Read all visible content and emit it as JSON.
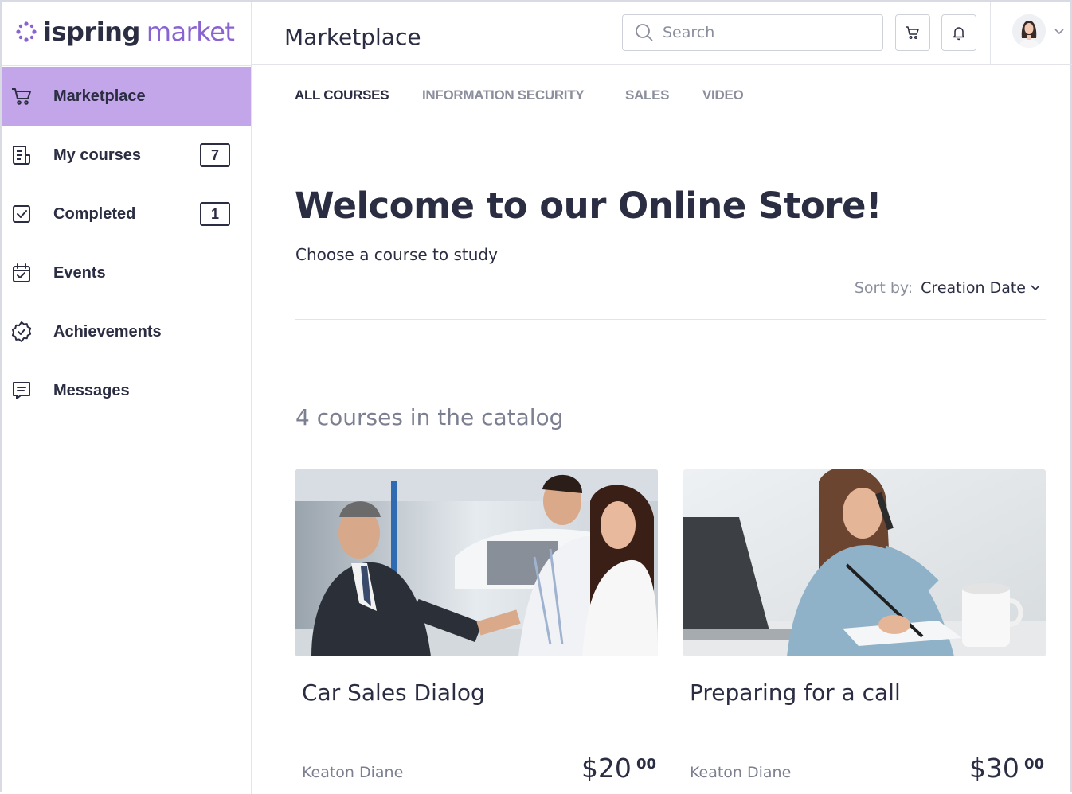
{
  "brand": {
    "name_part1": "ispring",
    "name_part2": "market",
    "accent": "#8a63d2"
  },
  "sidebar": {
    "items": [
      {
        "label": "Marketplace",
        "icon": "cart-icon",
        "active": true
      },
      {
        "label": "My courses",
        "icon": "courses-icon",
        "badge": "7"
      },
      {
        "label": "Completed",
        "icon": "checkbox-icon",
        "badge": "1"
      },
      {
        "label": "Events",
        "icon": "calendar-icon"
      },
      {
        "label": "Achievements",
        "icon": "medal-icon"
      },
      {
        "label": "Messages",
        "icon": "message-icon"
      }
    ],
    "active_color": "#c3a6ea"
  },
  "header": {
    "title": "Marketplace",
    "search_placeholder": "Search",
    "icons": [
      "search-icon",
      "cart-icon",
      "bell-icon",
      "avatar",
      "chevron-down-icon"
    ]
  },
  "tabs": [
    {
      "label": "ALL COURSES",
      "active": true
    },
    {
      "label": "INFORMATION SECURITY"
    },
    {
      "label": "SALES"
    },
    {
      "label": "VIDEO"
    }
  ],
  "main": {
    "welcome": "Welcome to our Online Store!",
    "subtitle": "Choose a course to study",
    "sort_label": "Sort by:",
    "sort_value": "Creation Date",
    "catalog_count": "4 courses in the catalog"
  },
  "courses": [
    {
      "title": "Car Sales Dialog",
      "author": "Keaton Diane",
      "price_main": "$20",
      "price_cents": "00"
    },
    {
      "title": "Preparing for a call",
      "author": "Keaton Diane",
      "price_main": "$30",
      "price_cents": "00"
    }
  ]
}
